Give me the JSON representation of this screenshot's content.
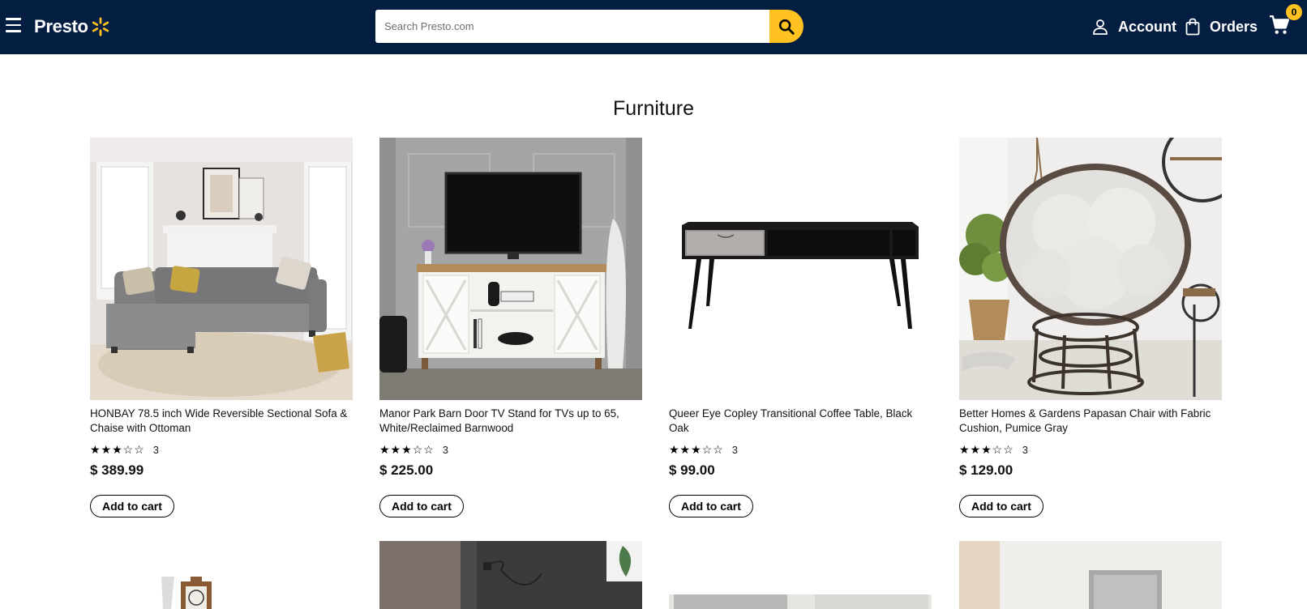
{
  "header": {
    "logo_text": "Presto",
    "search_placeholder": "Search Presto.com",
    "account_label": "Account",
    "orders_label": "Orders",
    "cart_count": "0",
    "colors": {
      "bar": "#041e42",
      "accent": "#ffc220"
    }
  },
  "page": {
    "title": "Furniture"
  },
  "products": [
    {
      "name": "HONBAY 78.5 inch Wide Reversible Sectional Sofa & Chaise with Ottoman",
      "stars": "★★★☆☆",
      "rating_count": "3",
      "price": "$ 389.99",
      "button": "Add to cart",
      "image": "gray-sectional-sofa"
    },
    {
      "name": "Manor Park Barn Door TV Stand for TVs up to 65, White/Reclaimed Barnwood",
      "stars": "★★★☆☆",
      "rating_count": "3",
      "price": "$ 225.00",
      "button": "Add to cart",
      "image": "white-tv-stand"
    },
    {
      "name": "Queer Eye Copley Transitional Coffee Table, Black Oak",
      "stars": "★★★☆☆",
      "rating_count": "3",
      "price": "$ 99.00",
      "button": "Add to cart",
      "image": "black-coffee-table"
    },
    {
      "name": "Better Homes & Gardens Papasan Chair with Fabric Cushion, Pumice Gray",
      "stars": "★★★☆☆",
      "rating_count": "3",
      "price": "$ 129.00",
      "button": "Add to cart",
      "image": "papasan-chair"
    }
  ],
  "icons": [
    "menu-icon",
    "spark-logo-icon",
    "search-icon",
    "account-icon",
    "orders-bag-icon",
    "cart-icon"
  ]
}
